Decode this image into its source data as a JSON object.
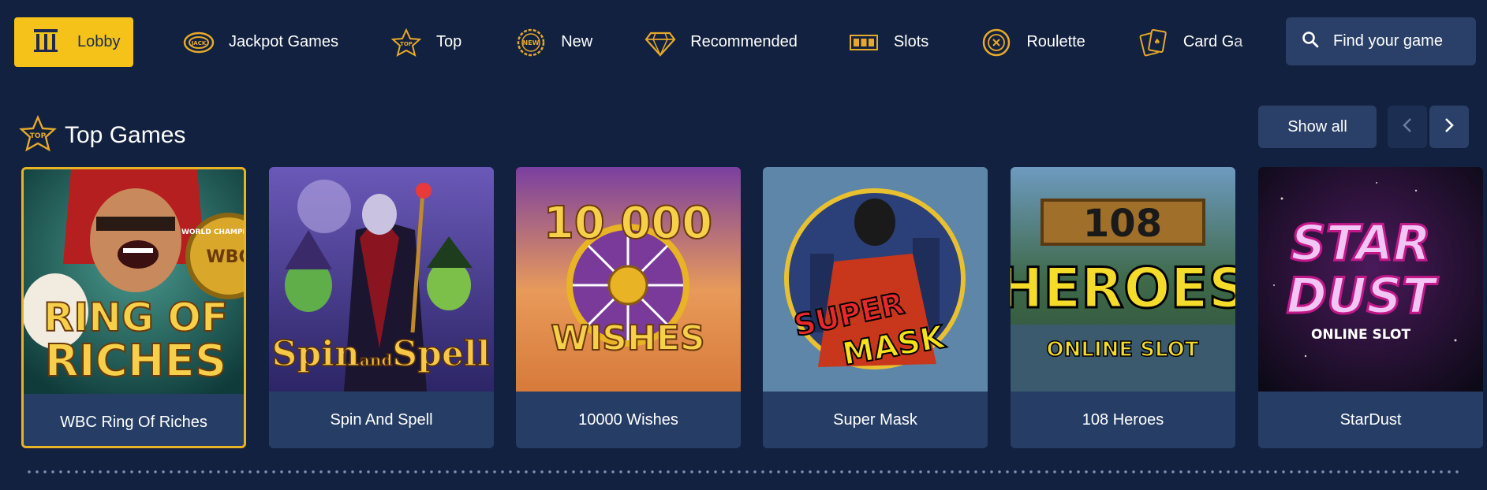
{
  "nav": {
    "lobby_label": "Lobby",
    "items": [
      {
        "label": "Jackpot Games",
        "icon": "jackpot-icon"
      },
      {
        "label": "Top",
        "icon": "top-star-icon"
      },
      {
        "label": "New",
        "icon": "new-badge-icon"
      },
      {
        "label": "Recommended",
        "icon": "diamond-icon"
      },
      {
        "label": "Slots",
        "icon": "slot-reels-icon"
      },
      {
        "label": "Roulette",
        "icon": "roulette-icon"
      },
      {
        "label": "Card Ga",
        "icon": "cards-icon"
      }
    ],
    "search_label": "Find your game"
  },
  "section": {
    "title": "Top Games",
    "badge": "TOP",
    "show_all_label": "Show all"
  },
  "games": [
    {
      "title": "WBC Ring Of Riches",
      "art_line1": "RING OF",
      "art_line2": "RICHES",
      "badge": "WBC",
      "arc_text": "WORLD CHAMPION"
    },
    {
      "title": "Spin And Spell",
      "art_line1": "Spin",
      "art_small": "and",
      "art_line2": "Spell"
    },
    {
      "title": "10000 Wishes",
      "art_line1": "10 000",
      "art_line2": "WISHES"
    },
    {
      "title": "Super Mask",
      "art_line1": "SUPER",
      "art_line2": "MASK"
    },
    {
      "title": "108 Heroes",
      "art_line1": "108",
      "art_line2": "HEROES",
      "art_line3": "ONLINE SLOT"
    },
    {
      "title": "StarDust",
      "art_line1": "STAR",
      "art_line2": "DUST",
      "art_line3": "ONLINE SLOT"
    }
  ],
  "colors": {
    "background": "#12213f",
    "accent": "#f5c219",
    "panel": "#2a4068",
    "card_label_bg": "#263e66"
  }
}
